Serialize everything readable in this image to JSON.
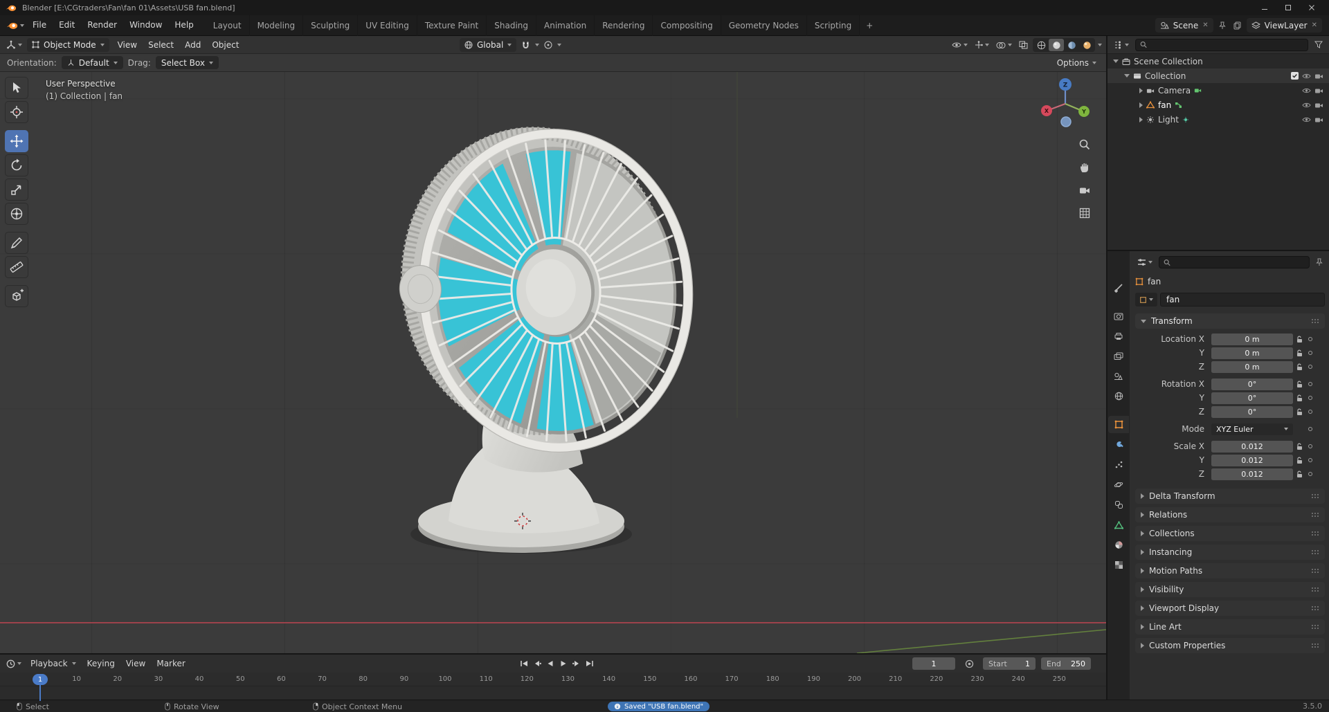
{
  "window": {
    "title": "Blender [E:\\CGtraders\\Fan\\fan 01\\Assets\\USB fan.blend]"
  },
  "topbar": {
    "menus": [
      "File",
      "Edit",
      "Render",
      "Window",
      "Help"
    ],
    "workspaces": [
      "Layout",
      "Modeling",
      "Sculpting",
      "UV Editing",
      "Texture Paint",
      "Shading",
      "Animation",
      "Rendering",
      "Compositing",
      "Geometry Nodes",
      "Scripting"
    ],
    "add_workspace_label": "+",
    "scene_label": "Scene",
    "view_layer_label": "ViewLayer"
  },
  "viewport": {
    "header": {
      "mode": "Object Mode",
      "menus": [
        "View",
        "Select",
        "Add",
        "Object"
      ],
      "orientation": "Global",
      "options_label": "Options"
    },
    "tool_settings": {
      "orientation_label": "Orientation:",
      "orientation_value": "Default",
      "drag_label": "Drag:",
      "drag_value": "Select Box"
    },
    "overlay": {
      "perspective": "User Perspective",
      "breadcrumb": "(1) Collection | fan"
    },
    "gizmo_axes": {
      "x": "X",
      "y": "Y",
      "z": "Z"
    },
    "toolbar_tools": [
      "tweak-select",
      "cursor-3d",
      "move",
      "rotate",
      "scale",
      "transform",
      "annotate",
      "measure",
      "add-cube"
    ],
    "active_tool": "move"
  },
  "outliner": {
    "rows": [
      {
        "label": "Scene Collection"
      },
      {
        "label": "Collection"
      },
      {
        "label": "Camera"
      },
      {
        "label": "fan"
      },
      {
        "label": "Light"
      }
    ]
  },
  "properties": {
    "breadcrumb": "fan",
    "object_name": "fan",
    "tab_icons": [
      "tool",
      "render",
      "output",
      "view-layer",
      "scene",
      "world",
      "object",
      "modifiers",
      "particles",
      "physics",
      "constraints",
      "object-data",
      "material",
      "texture"
    ],
    "active_tab": "object",
    "transform": {
      "title": "Transform",
      "rows": [
        {
          "label": "Location X",
          "value": "0 m"
        },
        {
          "label": "Y",
          "value": "0 m"
        },
        {
          "label": "Z",
          "value": "0 m"
        },
        {
          "label": "Rotation X",
          "value": "0°"
        },
        {
          "label": "Y",
          "value": "0°"
        },
        {
          "label": "Z",
          "value": "0°"
        },
        {
          "label": "Mode",
          "value": "XYZ Euler"
        },
        {
          "label": "Scale X",
          "value": "0.012"
        },
        {
          "label": "Y",
          "value": "0.012"
        },
        {
          "label": "Z",
          "value": "0.012"
        }
      ]
    },
    "sections": [
      "Delta Transform",
      "Relations",
      "Collections",
      "Instancing",
      "Motion Paths",
      "Visibility",
      "Viewport Display",
      "Line Art",
      "Custom Properties"
    ]
  },
  "timeline": {
    "menus": [
      "Playback",
      "Keying",
      "View",
      "Marker"
    ],
    "current_frame": "1",
    "start_label": "Start",
    "start_value": "1",
    "end_label": "End",
    "end_value": "250",
    "ticks": [
      "10",
      "20",
      "30",
      "40",
      "50",
      "60",
      "70",
      "80",
      "90",
      "100",
      "110",
      "120",
      "130",
      "140",
      "150",
      "160",
      "170",
      "180",
      "190",
      "200",
      "210",
      "220",
      "230",
      "240",
      "250"
    ]
  },
  "statusbar": {
    "hints": [
      "Select",
      "Rotate View",
      "Object Context Menu"
    ],
    "saved_message": "Saved \"USB fan.blend\"",
    "version": "3.5.0"
  },
  "colors": {
    "accent_blue": "#4772b3",
    "object_orange": "#e8913c",
    "fan_cyan": "#38c3d6"
  }
}
